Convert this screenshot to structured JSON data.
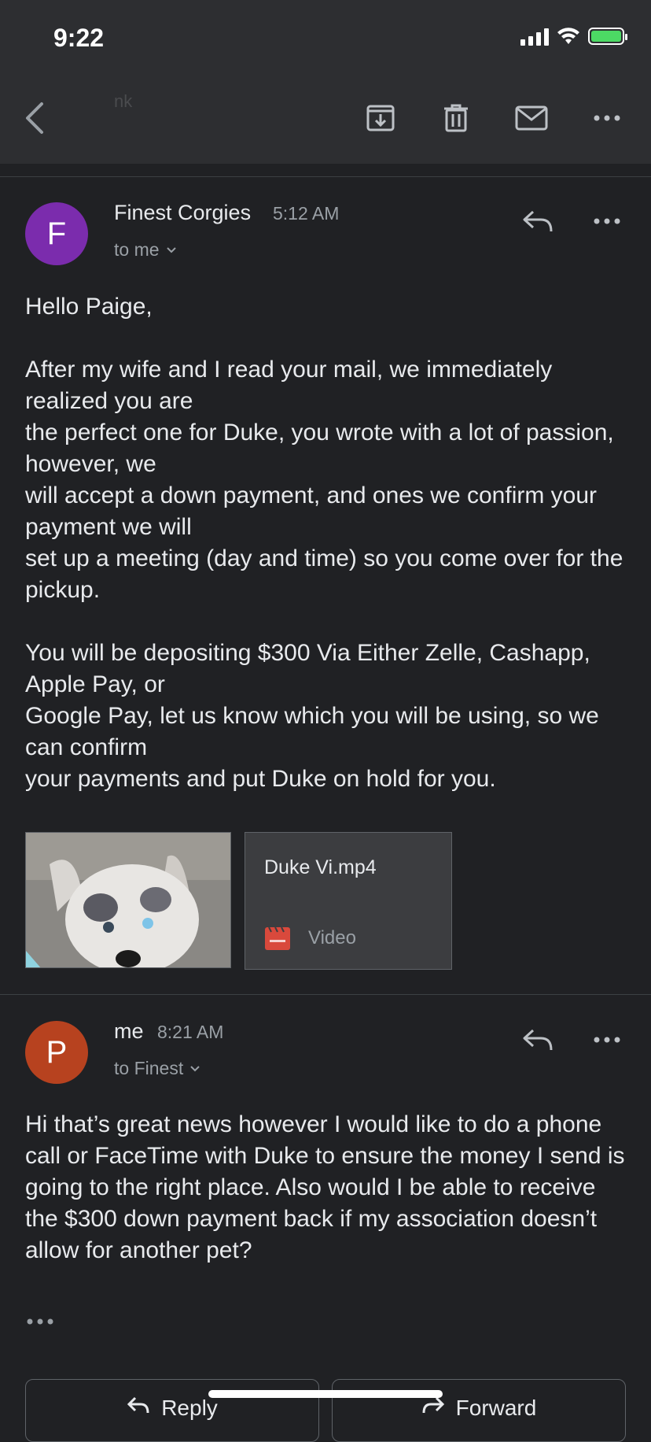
{
  "status_bar": {
    "time": "9:22"
  },
  "toolbar": {
    "subject_fragment": "nk"
  },
  "colors": {
    "background": "#202124",
    "avatar_f": "#7b2cad",
    "avatar_p": "#b7421f",
    "video_icon": "#d9493c",
    "battery": "#4cd964"
  },
  "message1": {
    "avatar_letter": "F",
    "sender": "Finest Corgies",
    "time": "5:12 AM",
    "recipient": "to me",
    "body": "Hello Paige,\n\nAfter my wife and I read your mail, we immediately realized you are\nthe perfect one for Duke, you wrote with a lot of passion, however, we\nwill accept a down payment, and ones we confirm your payment we will\nset up a meeting (day and time) so you come over for the pickup.\n\nYou will be depositing $300 Via Either Zelle, Cashapp,  Apple Pay, or\nGoogle Pay, let us know which you will be using, so we can confirm\nyour payments and put Duke on hold for you.",
    "attachments": {
      "video_name": "Duke Vi.mp4",
      "video_type": "Video"
    }
  },
  "message2": {
    "avatar_letter": "P",
    "sender": "me",
    "time": "8:21 AM",
    "recipient": "to Finest",
    "body": "Hi that’s great news however I would like to do a phone call or FaceTime with Duke to ensure the money I send is going to the right place. Also would I be able to receive the $300 down payment back if my association doesn’t allow for another pet?"
  },
  "actions": {
    "reply": "Reply",
    "forward": "Forward"
  }
}
